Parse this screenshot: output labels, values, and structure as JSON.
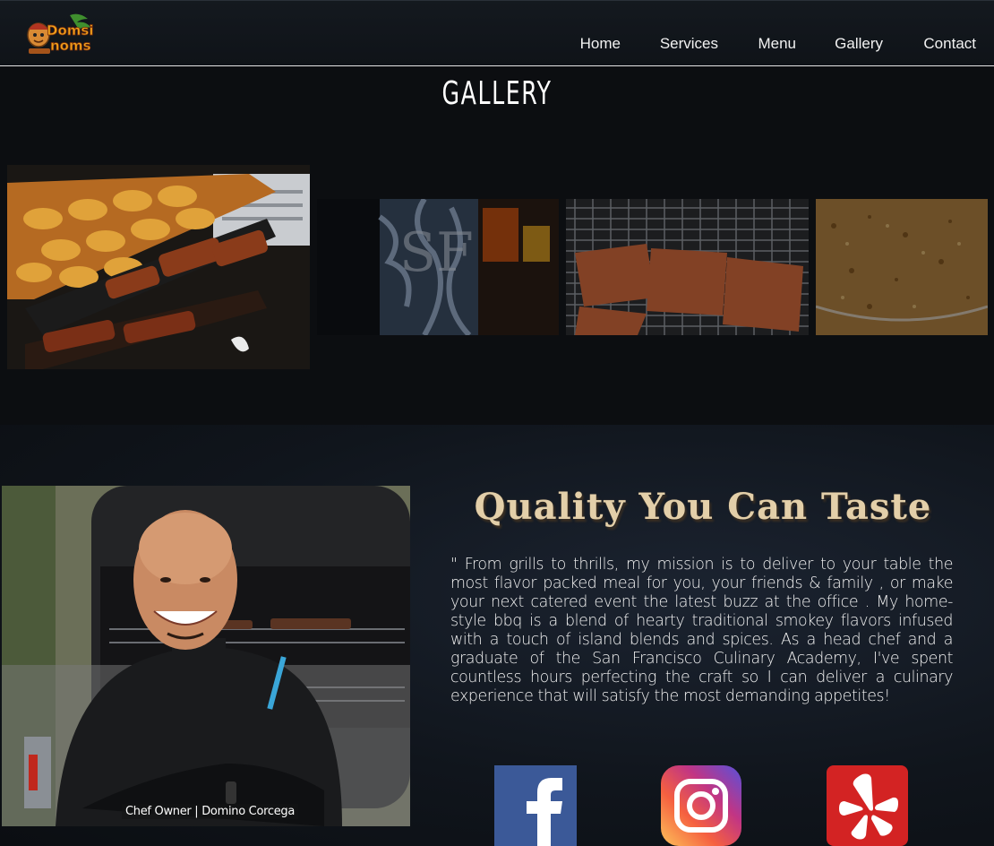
{
  "brand": {
    "logo_text_top": "Domsi",
    "logo_text_bottom": "noms"
  },
  "nav": {
    "items": [
      {
        "label": "Home"
      },
      {
        "label": "Services"
      },
      {
        "label": "Menu"
      },
      {
        "label": "Gallery"
      },
      {
        "label": "Contact"
      }
    ]
  },
  "gallery": {
    "title": "GALLERY",
    "photos": [
      {
        "icon": "grilled-chicken-and-ribs-image"
      },
      {
        "icon": "sf-giants-smoker-image"
      },
      {
        "icon": "ribs-on-grill-image"
      },
      {
        "icon": "spice-rub-image"
      }
    ]
  },
  "about": {
    "tagline": "Quality You Can Taste",
    "bio": "\" From grills to thrills, my mission is to deliver to your table the most flavor packed meal for you, your friends & family , or make your next catered event the latest buzz at the office . My home-style bbq is a blend of hearty traditional smokey flavors infused with a touch of island blends and spices. As a head chef and a graduate of the San Francisco Culinary Academy, I've spent countless hours perfecting the craft so I can deliver a culinary experience that will satisfy the most demanding appetites!",
    "chef_caption": "Chef Owner | Domino Corcega"
  },
  "social": [
    {
      "icon": "facebook-icon",
      "color": "#3b5998"
    },
    {
      "icon": "instagram-icon",
      "color": "#c13584"
    },
    {
      "icon": "yelp-icon",
      "color": "#d32323"
    }
  ]
}
